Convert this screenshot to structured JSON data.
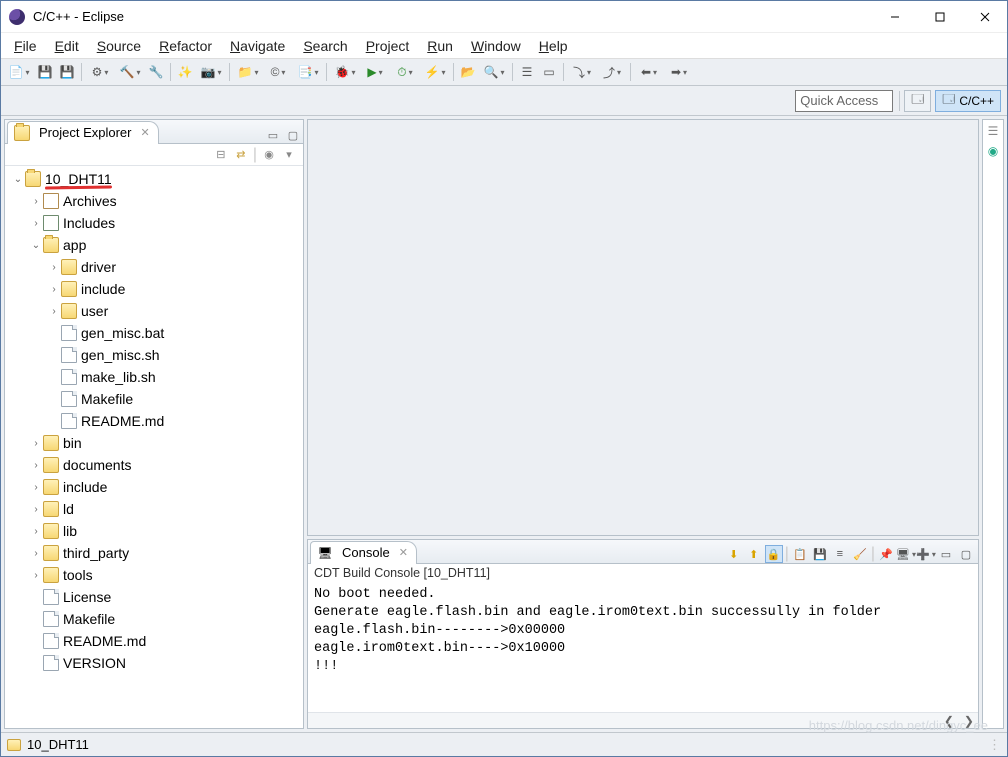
{
  "window": {
    "title": "C/C++ - Eclipse"
  },
  "menu": [
    "File",
    "Edit",
    "Source",
    "Refactor",
    "Navigate",
    "Search",
    "Project",
    "Run",
    "Window",
    "Help"
  ],
  "quick_access": {
    "placeholder": "Quick Access"
  },
  "perspective": {
    "active_label": "C/C++"
  },
  "project_explorer": {
    "tab_label": "Project Explorer",
    "tree": [
      {
        "depth": 0,
        "label": "10_DHT11",
        "icon": "proj",
        "exp": "open",
        "hl": true
      },
      {
        "depth": 1,
        "label": "Archives",
        "icon": "arch",
        "exp": "closed"
      },
      {
        "depth": 1,
        "label": "Includes",
        "icon": "inc",
        "exp": "closed"
      },
      {
        "depth": 1,
        "label": "app",
        "icon": "folder",
        "exp": "open"
      },
      {
        "depth": 2,
        "label": "driver",
        "icon": "folder",
        "exp": "closed"
      },
      {
        "depth": 2,
        "label": "include",
        "icon": "folder",
        "exp": "closed"
      },
      {
        "depth": 2,
        "label": "user",
        "icon": "folder",
        "exp": "closed"
      },
      {
        "depth": 2,
        "label": "gen_misc.bat",
        "icon": "file",
        "exp": "none"
      },
      {
        "depth": 2,
        "label": "gen_misc.sh",
        "icon": "file",
        "exp": "none"
      },
      {
        "depth": 2,
        "label": "make_lib.sh",
        "icon": "file",
        "exp": "none"
      },
      {
        "depth": 2,
        "label": "Makefile",
        "icon": "file",
        "exp": "none"
      },
      {
        "depth": 2,
        "label": "README.md",
        "icon": "file",
        "exp": "none"
      },
      {
        "depth": 1,
        "label": "bin",
        "icon": "folder",
        "exp": "closed"
      },
      {
        "depth": 1,
        "label": "documents",
        "icon": "folder",
        "exp": "closed"
      },
      {
        "depth": 1,
        "label": "include",
        "icon": "folder",
        "exp": "closed"
      },
      {
        "depth": 1,
        "label": "ld",
        "icon": "folder",
        "exp": "closed"
      },
      {
        "depth": 1,
        "label": "lib",
        "icon": "folder",
        "exp": "closed"
      },
      {
        "depth": 1,
        "label": "third_party",
        "icon": "folder",
        "exp": "closed"
      },
      {
        "depth": 1,
        "label": "tools",
        "icon": "folder",
        "exp": "closed"
      },
      {
        "depth": 1,
        "label": "License",
        "icon": "file",
        "exp": "none"
      },
      {
        "depth": 1,
        "label": "Makefile",
        "icon": "file",
        "exp": "none"
      },
      {
        "depth": 1,
        "label": "README.md",
        "icon": "file",
        "exp": "none"
      },
      {
        "depth": 1,
        "label": "VERSION",
        "icon": "file",
        "exp": "none"
      }
    ]
  },
  "console": {
    "tab_label": "Console",
    "title": "CDT Build Console [10_DHT11]",
    "lines": [
      "No boot needed.",
      "Generate eagle.flash.bin and eagle.irom0text.bin successully in folder",
      "eagle.flash.bin-------->0x00000",
      "eagle.irom0text.bin---->0x10000",
      "!!!"
    ]
  },
  "status": {
    "project": "10_DHT11"
  },
  "watermark": "https://blog.csdn.net/dingyc_ee"
}
